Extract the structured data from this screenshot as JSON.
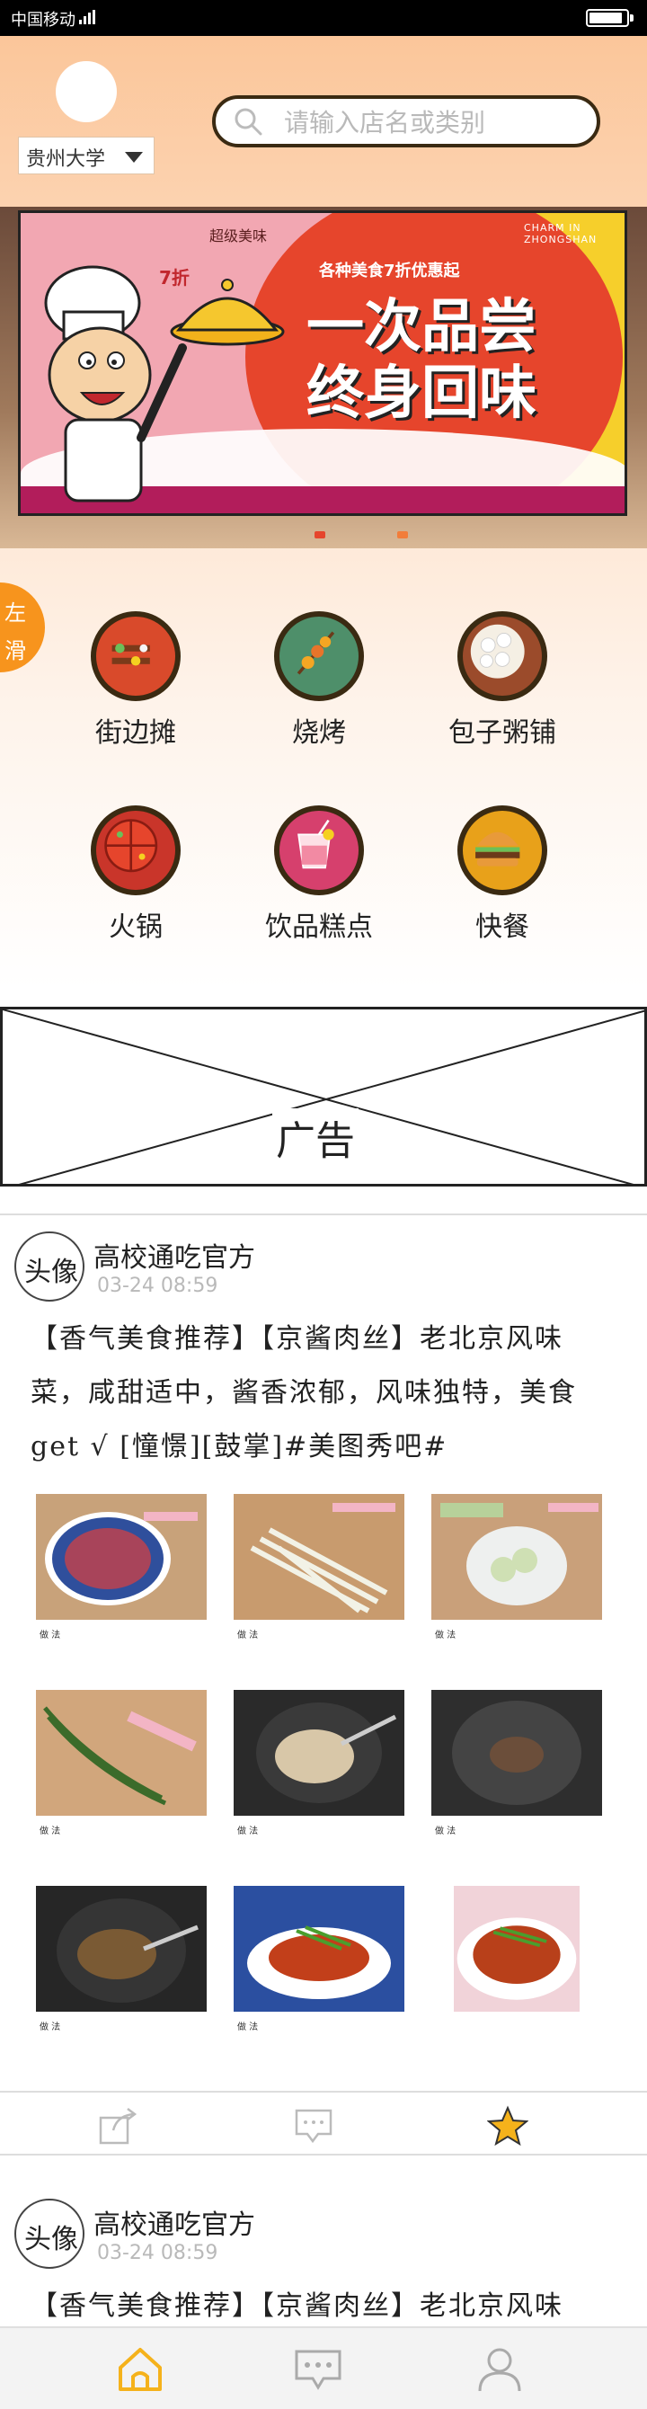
{
  "status_bar": {
    "carrier": "中国移动"
  },
  "header": {
    "school": "贵州大学",
    "search_placeholder": "请输入店名或类别"
  },
  "banner": {
    "small_title": "CHARM IN ZHONGSHAN",
    "subtitle": "各种美食7折优惠起",
    "headline_line1": "一次品尝",
    "headline_line2": "终身回味",
    "discount": "7折",
    "super": "超级美味"
  },
  "slide_tab": {
    "char1": "左",
    "char2": "滑"
  },
  "categories": [
    {
      "label": "街边摊",
      "color": "#d94a2b"
    },
    {
      "label": "烧烤",
      "color": "#4e8f6a"
    },
    {
      "label": "包子粥铺",
      "color": "#9b4b2b"
    },
    {
      "label": "火锅",
      "color": "#c9352a"
    },
    {
      "label": "饮品糕点",
      "color": "#d6406d"
    },
    {
      "label": "快餐",
      "color": "#e8a11a"
    }
  ],
  "ad": {
    "label": "广告"
  },
  "posts": [
    {
      "avatar": "头像",
      "author": "高校通吃官方",
      "time": "03-24 08:59",
      "text": "【香气美食推荐】【京酱肉丝】老北京风味菜，咸甜适中，酱香浓郁，风味独特，美食get √  [憧憬][鼓掌]#美图秀吧#"
    },
    {
      "avatar": "头像",
      "author": "高校通吃官方",
      "time": "03-24 08:59",
      "text": "【香气美食推荐】【京酱肉丝】老北京风味"
    }
  ],
  "grid_caption": "做 法",
  "colors": {
    "accent": "#f7941d",
    "star": "#f5b21b",
    "home": "#f5b21b"
  },
  "icons": [
    "search-icon",
    "share-icon",
    "comment-icon",
    "star-icon",
    "home-icon",
    "message-icon",
    "profile-icon"
  ]
}
